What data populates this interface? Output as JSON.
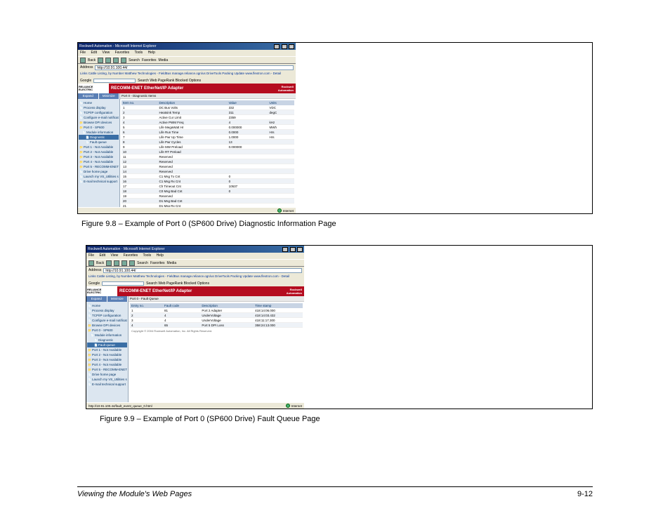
{
  "footer": {
    "title": "Viewing the Module's Web Pages",
    "page": "9-12"
  },
  "captions": {
    "fig98": "Figure 9.8 – Example of Port 0 (SP600 Drive) Diagnostic Information Page",
    "fig99": "Figure 9.9 – Example of Port 0 (SP600 Drive) Fault Queue Page"
  },
  "ie": {
    "title1": "Rockwell Automation - Microsoft Internet Explorer",
    "title2": "Rockwell Automation - Microsoft Internet Explorer",
    "menu": {
      "file": "File",
      "edit": "Edit",
      "view": "View",
      "fav": "Favorites",
      "tools": "Tools",
      "help": "Help"
    },
    "tb": {
      "back": "Back",
      "search": "Search",
      "fav": "Favorites",
      "media": "Media"
    },
    "addr_label": "Address",
    "addr1": "http://10.91.100.44/",
    "addr2": "http://10.91.100.44/",
    "links_label": "Links",
    "links_list": "Cattle Listing, by Number   Matthew Technologies - FieldBus   manage.reliance.ogn/us   DriveTools Packing Update   www.flextron.com - Detail",
    "google": "Google",
    "google_btns": "Search Web   PageRank   Blocked   Options",
    "status_url2": "http://10.91.100.44/fault_event_queue_0.html",
    "status_net": "Internet"
  },
  "banner": {
    "logo_l1": "RELIANCE",
    "logo_l2": "ELECTRIC",
    "title": "RECOMM-ENET EtherNet/IP Adapter",
    "ra_l1": "Rockwell",
    "ra_l2": "Automation"
  },
  "nav": {
    "tab_expand": "Expand",
    "tab_minimize": "Minimize",
    "items": [
      "Home",
      "Process display",
      "TCP/IP configuration",
      "Configure e-mail notification",
      "Browse DPI devices",
      "Port 0 - SP600",
      "Module information",
      "Diagnostic",
      "Fault queue",
      "Port 1 - Not Available",
      "Port 2 - Not Available",
      "Port 3 - Not Available",
      "Port 4 - Not Available",
      "Port 5 - RECOMM-ENET",
      "Drive home page",
      "Launch my VS_Utilities softw",
      "E-mail technical support"
    ]
  },
  "diag": {
    "tab": "Port 0 - Diagnostic Items",
    "headers": {
      "no": "Item no.",
      "desc": "Description",
      "val": "Value",
      "units": "Units"
    },
    "rows": [
      {
        "n": "1",
        "d": "DC Bus Volts",
        "v": "332",
        "u": "VDC"
      },
      {
        "n": "2",
        "d": "Heatsink Temp",
        "v": "311",
        "u": "degC"
      },
      {
        "n": "3",
        "d": "Active Cur Limit",
        "v": "2359",
        "u": ""
      },
      {
        "n": "4",
        "d": "Active PWM Freq",
        "v": "4",
        "u": "kHz"
      },
      {
        "n": "5",
        "d": "Life MegaWatt Hr",
        "v": "0.000000",
        "u": "MWh"
      },
      {
        "n": "6",
        "d": "Life Run Time",
        "v": "0.0000",
        "u": "Hrs"
      },
      {
        "n": "7",
        "d": "Life Pwr Up Time",
        "v": "1.0000",
        "u": "Hrs"
      },
      {
        "n": "8",
        "d": "Life Pwr Cycles",
        "v": "13",
        "u": ""
      },
      {
        "n": "9",
        "d": "Life MW Preload",
        "v": "0.000000",
        "u": ""
      },
      {
        "n": "10",
        "d": "Life RT Preload",
        "v": "",
        "u": ""
      },
      {
        "n": "11",
        "d": "Reserved",
        "v": "",
        "u": ""
      },
      {
        "n": "12",
        "d": "Reserved",
        "v": "",
        "u": ""
      },
      {
        "n": "13",
        "d": "Reserved",
        "v": "",
        "u": ""
      },
      {
        "n": "14",
        "d": "Reserved",
        "v": "",
        "u": ""
      },
      {
        "n": "15",
        "d": "C1 Msg Tx Cnt",
        "v": "0",
        "u": ""
      },
      {
        "n": "16",
        "d": "C1 Msg Rx Cnt",
        "v": "0",
        "u": ""
      },
      {
        "n": "17",
        "d": "Ch Timeout Cnt",
        "v": "10537",
        "u": ""
      },
      {
        "n": "18",
        "d": "C0 Msg Bad Cnt",
        "v": "0",
        "u": ""
      },
      {
        "n": "19",
        "d": "Reserved",
        "v": "",
        "u": ""
      },
      {
        "n": "20",
        "d": "D1 Msg Bad Cnt",
        "v": "",
        "u": ""
      },
      {
        "n": "21",
        "d": "D1 Msg Rx Cnt",
        "v": "",
        "u": ""
      }
    ]
  },
  "fault": {
    "tab": "Port 0 - Fault Queue",
    "headers": {
      "e": "Entry no.",
      "c": "Fault code",
      "d": "Description",
      "t": "Time stamp"
    },
    "rows": [
      {
        "e": "1",
        "c": "81",
        "d": "Port 2 Adapter",
        "t": "418:14:06.000"
      },
      {
        "e": "2",
        "c": "4",
        "d": "UnderVoltage",
        "t": "418:14:03.432"
      },
      {
        "e": "3",
        "c": "4",
        "d": "UnderVoltage",
        "t": "418:11:17.300"
      },
      {
        "e": "4",
        "c": "65",
        "d": "Port 5 DPI Loss",
        "t": "358:24:13.000"
      }
    ],
    "copyright": "Copyright © 2004 Rockwell Automation, Inc. All Rights Reserved."
  }
}
